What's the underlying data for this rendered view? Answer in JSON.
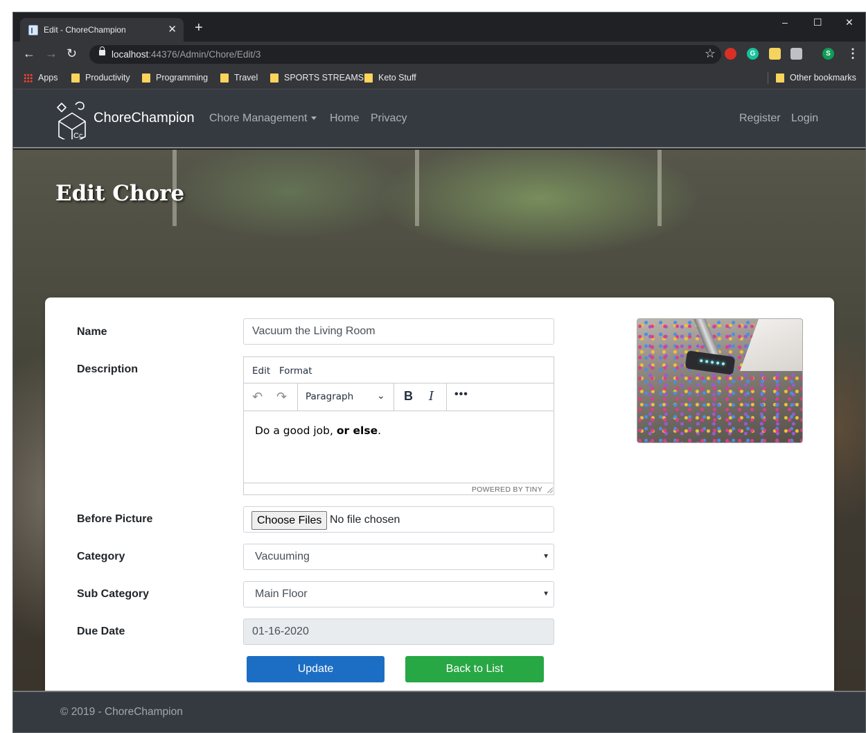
{
  "browser": {
    "tab_title": "Edit - ChoreChampion",
    "tab_close": "✕",
    "new_tab": "+",
    "url_host": "localhost",
    "url_rest": ":44376/Admin/Chore/Edit/3",
    "window_controls": [
      "–",
      "☐",
      "✕"
    ]
  },
  "bookmarks": {
    "items": [
      "Apps",
      "Productivity",
      "Programming",
      "Travel",
      "SPORTS STREAMS",
      "Keto Stuff"
    ],
    "other": "Other bookmarks"
  },
  "extensions": {
    "profile_initial": "S",
    "grammarly_initial": "G"
  },
  "site": {
    "brand": "ChoreChampion",
    "nav_links": [
      "Chore Management",
      "Home",
      "Privacy"
    ],
    "auth_links": [
      "Register",
      "Login"
    ]
  },
  "page": {
    "title": "Edit Chore"
  },
  "form": {
    "name_label": "Name",
    "name_value": "Vacuum the Living Room",
    "description_label": "Description",
    "before_picture_label": "Before Picture",
    "category_label": "Category",
    "category_value": "Vacuuming",
    "subcategory_label": "Sub Category",
    "subcategory_value": "Main Floor",
    "due_date_label": "Due Date",
    "due_date_value": "01-16-2020",
    "file_button": "Choose Files",
    "file_status": "No file chosen",
    "update_button": "Update",
    "back_button": "Back to List"
  },
  "editor": {
    "menu": [
      "Edit",
      "Format"
    ],
    "block_format": "Paragraph",
    "content_plain": "Do a good job, ",
    "content_bold": "or else",
    "content_end": ".",
    "powered_by": "POWERED BY TINY"
  },
  "footer": {
    "text": "© 2019 - ChoreChampion"
  },
  "colors": {
    "navbar_bg": "#343a40",
    "primary": "#1c6ec4",
    "success": "#28a745"
  }
}
